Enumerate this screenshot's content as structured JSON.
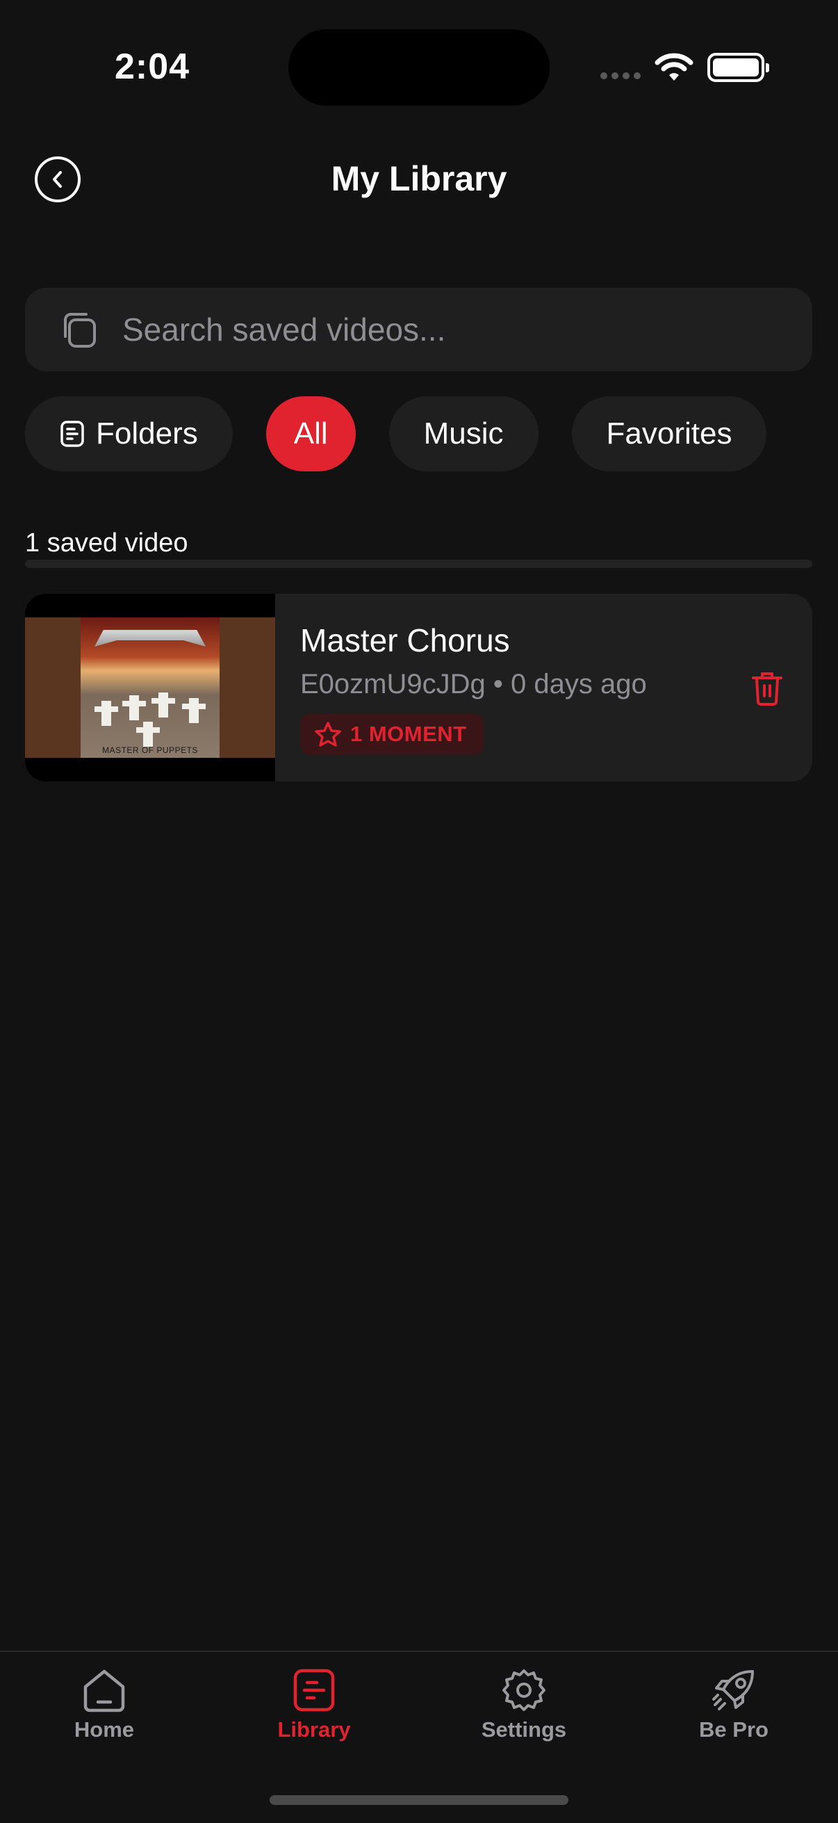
{
  "status_bar": {
    "time": "2:04"
  },
  "header": {
    "title": "My Library"
  },
  "search": {
    "placeholder": "Search saved videos..."
  },
  "filters": [
    {
      "label": "Folders",
      "icon": "folder-icon",
      "active": false
    },
    {
      "label": "All",
      "active": true
    },
    {
      "label": "Music",
      "active": false
    },
    {
      "label": "Favorites",
      "active": false
    }
  ],
  "library": {
    "count_label": "1 saved video",
    "videos": [
      {
        "title": "Master Chorus",
        "meta": "E0ozmU9cJDg • 0 days ago",
        "badge": "1 MOMENT",
        "thumbnail_caption": "MASTER OF PUPPETS"
      }
    ]
  },
  "bottom_nav": [
    {
      "label": "Home",
      "icon": "home-icon",
      "active": false
    },
    {
      "label": "Library",
      "icon": "library-icon",
      "active": true
    },
    {
      "label": "Settings",
      "icon": "gear-icon",
      "active": false
    },
    {
      "label": "Be Pro",
      "icon": "rocket-icon",
      "active": false
    }
  ],
  "colors": {
    "accent": "#e0232f",
    "background": "#121212",
    "surface": "#1f1f1f",
    "muted_text": "#8e8e93"
  }
}
